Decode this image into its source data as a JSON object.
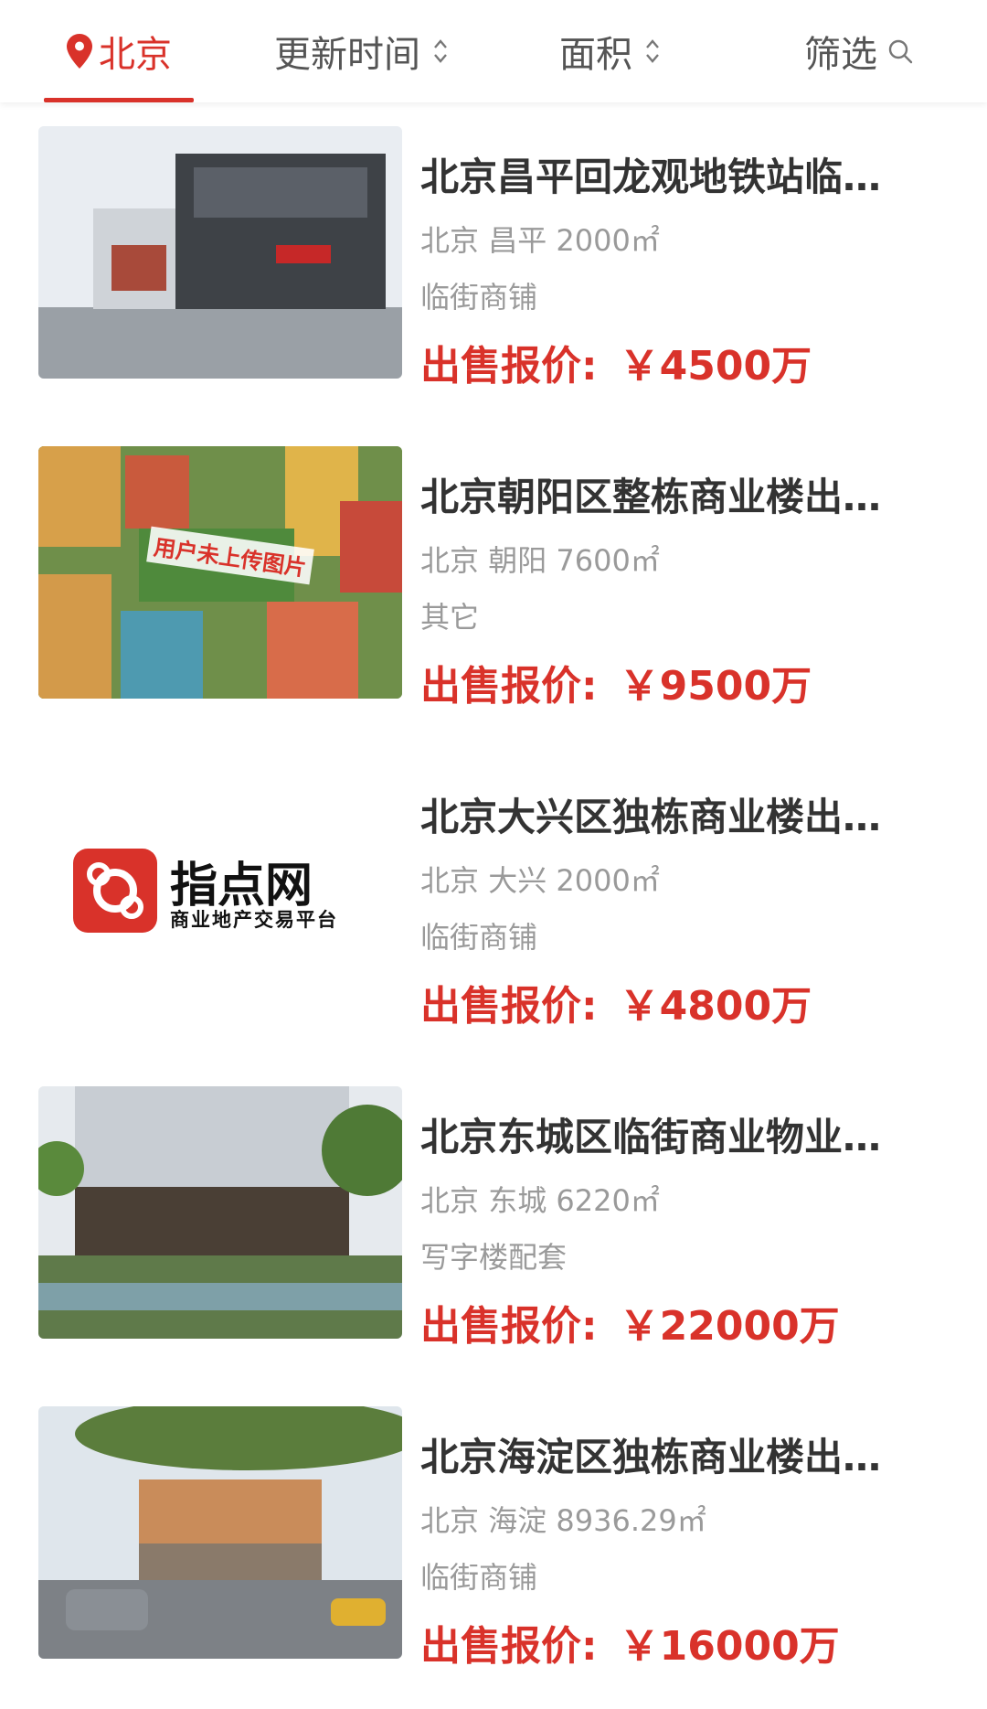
{
  "header": {
    "city": "北京",
    "sort_time": "更新时间",
    "sort_area": "面积",
    "filter": "筛选"
  },
  "listings": [
    {
      "title": "北京昌平回龙观地铁站临…",
      "city": "北京",
      "district": "昌平",
      "area": "2000㎡",
      "type": "临街商铺",
      "price_label": "出售报价:",
      "price": "￥4500万"
    },
    {
      "title": "北京朝阳区整栋商业楼出…",
      "city": "北京",
      "district": "朝阳",
      "area": "7600㎡",
      "type": "其它",
      "price_label": "出售报价:",
      "price": "￥9500万",
      "image_caption": "用户未上传图片"
    },
    {
      "title": "北京大兴区独栋商业楼出…",
      "city": "北京",
      "district": "大兴",
      "area": "2000㎡",
      "type": "临街商铺",
      "price_label": "出售报价:",
      "price": "￥4800万",
      "logo_name": "指点网",
      "logo_sub": "商业地产交易平台"
    },
    {
      "title": "北京东城区临街商业物业…",
      "city": "北京",
      "district": "东城",
      "area": "6220㎡",
      "type": "写字楼配套",
      "price_label": "出售报价:",
      "price": "￥22000万"
    },
    {
      "title": "北京海淀区独栋商业楼出…",
      "city": "北京",
      "district": "海淀",
      "area": "8936.29㎡",
      "type": "临街商铺",
      "price_label": "出售报价:",
      "price": "￥16000万"
    }
  ],
  "colors": {
    "accent": "#d9322a",
    "text": "#333333",
    "muted": "#9a9a9a"
  }
}
